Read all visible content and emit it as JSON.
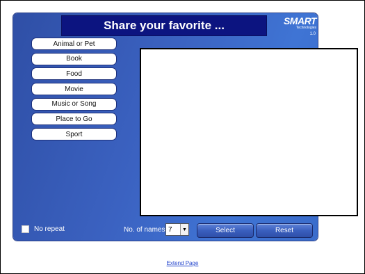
{
  "title": "Share your favorite ...",
  "logo": {
    "brand": "SMART",
    "sub": "Technologies"
  },
  "version": "1.0",
  "categories": [
    "Animal or Pet",
    "Book",
    "Food",
    "Movie",
    "Music or Song",
    "Place to Go",
    "Sport"
  ],
  "controls": {
    "no_repeat_label": "No repeat",
    "no_repeat_checked": false,
    "no_of_names_label": "No. of names",
    "no_of_names_value": "7",
    "select_label": "Select",
    "reset_label": "Reset"
  },
  "footer": {
    "extend_page": "Extend Page"
  },
  "colors": {
    "title_bg": "#0c1480",
    "panel_blue": "#3b62c1",
    "link": "#2244cc"
  }
}
